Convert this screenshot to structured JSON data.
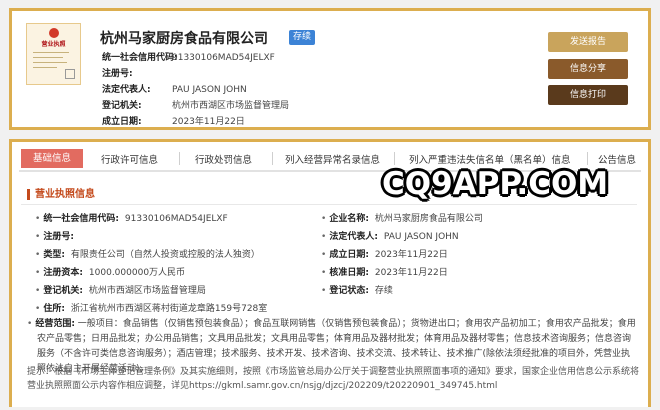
{
  "company": {
    "name": "杭州马家厨房食品有限公司",
    "status": "存续",
    "rows": [
      {
        "label": "统一社会信用代码:",
        "value": "91330106MAD54JELXF"
      },
      {
        "label": "注册号:",
        "value": ""
      },
      {
        "label": "法定代表人:",
        "value": "PAU JASON JOHN"
      },
      {
        "label": "登记机关:",
        "value": "杭州市西湖区市场监督管理局"
      },
      {
        "label": "成立日期:",
        "value": "2023年11月22日"
      }
    ],
    "license_icon_text": "营业执照"
  },
  "actions": {
    "send_report": "发送报告",
    "share": "信息分享",
    "print": "信息打印",
    "colors": {
      "gold": "#c9a45c",
      "brown": "#8a5a2b",
      "dark": "#5a3a1c"
    }
  },
  "tabs": [
    "基础信息",
    "行政许可信息",
    "行政处罚信息",
    "列入经营异常名录信息",
    "列入严重违法失信名单（黑名单）信息",
    "公告信息"
  ],
  "watermark": "CQ9APP.COM",
  "section": {
    "title": "营业执照信息",
    "fields": [
      {
        "label": "统一社会信用代码:",
        "value": "91330106MAD54JELXF"
      },
      {
        "label": "企业名称:",
        "value": "杭州马家厨房食品有限公司"
      },
      {
        "label": "注册号:",
        "value": ""
      },
      {
        "label": "法定代表人:",
        "value": "PAU JASON JOHN"
      },
      {
        "label": "类型:",
        "value": "有限责任公司（自然人投资或控股的法人独资）"
      },
      {
        "label": "成立日期:",
        "value": "2023年11月22日"
      },
      {
        "label": "注册资本:",
        "value": "1000.000000万人民币"
      },
      {
        "label": "核准日期:",
        "value": "2023年11月22日"
      },
      {
        "label": "登记机关:",
        "value": "杭州市西湖区市场监督管理局"
      },
      {
        "label": "登记状态:",
        "value": "存续"
      },
      {
        "label": "住所:",
        "value": "浙江省杭州市西湖区蒋村街道龙章路159号728室"
      }
    ],
    "scope_label": "经营范围:",
    "scope_text": "一般项目：食品销售（仅销售预包装食品）；食品互联网销售（仅销售预包装食品）；货物进出口；食用农产品初加工；食用农产品批发；食用农产品零售；日用品批发；办公用品销售；文具用品批发；文具用品零售；体育用品及器材批发；体育用品及器材零售；信息技术咨询服务；信息咨询服务（不含许可类信息咨询服务）；酒店管理；技术服务、技术开发、技术咨询、技术交流、技术转让、技术推广(除依法须经批准的项目外，凭营业执照依法自主开展经营活动)。",
    "tip": "提示：根据《市场主体登记管理条例》及其实施细则，按照《市场监管总局办公厅关于调整营业执照照面事项的通知》要求，国家企业信用信息公示系统将营业执照照面公示内容作相应调整，详见https://gkml.samr.gov.cn/nsjg/djzcj/202209/t20220901_349745.html"
  }
}
